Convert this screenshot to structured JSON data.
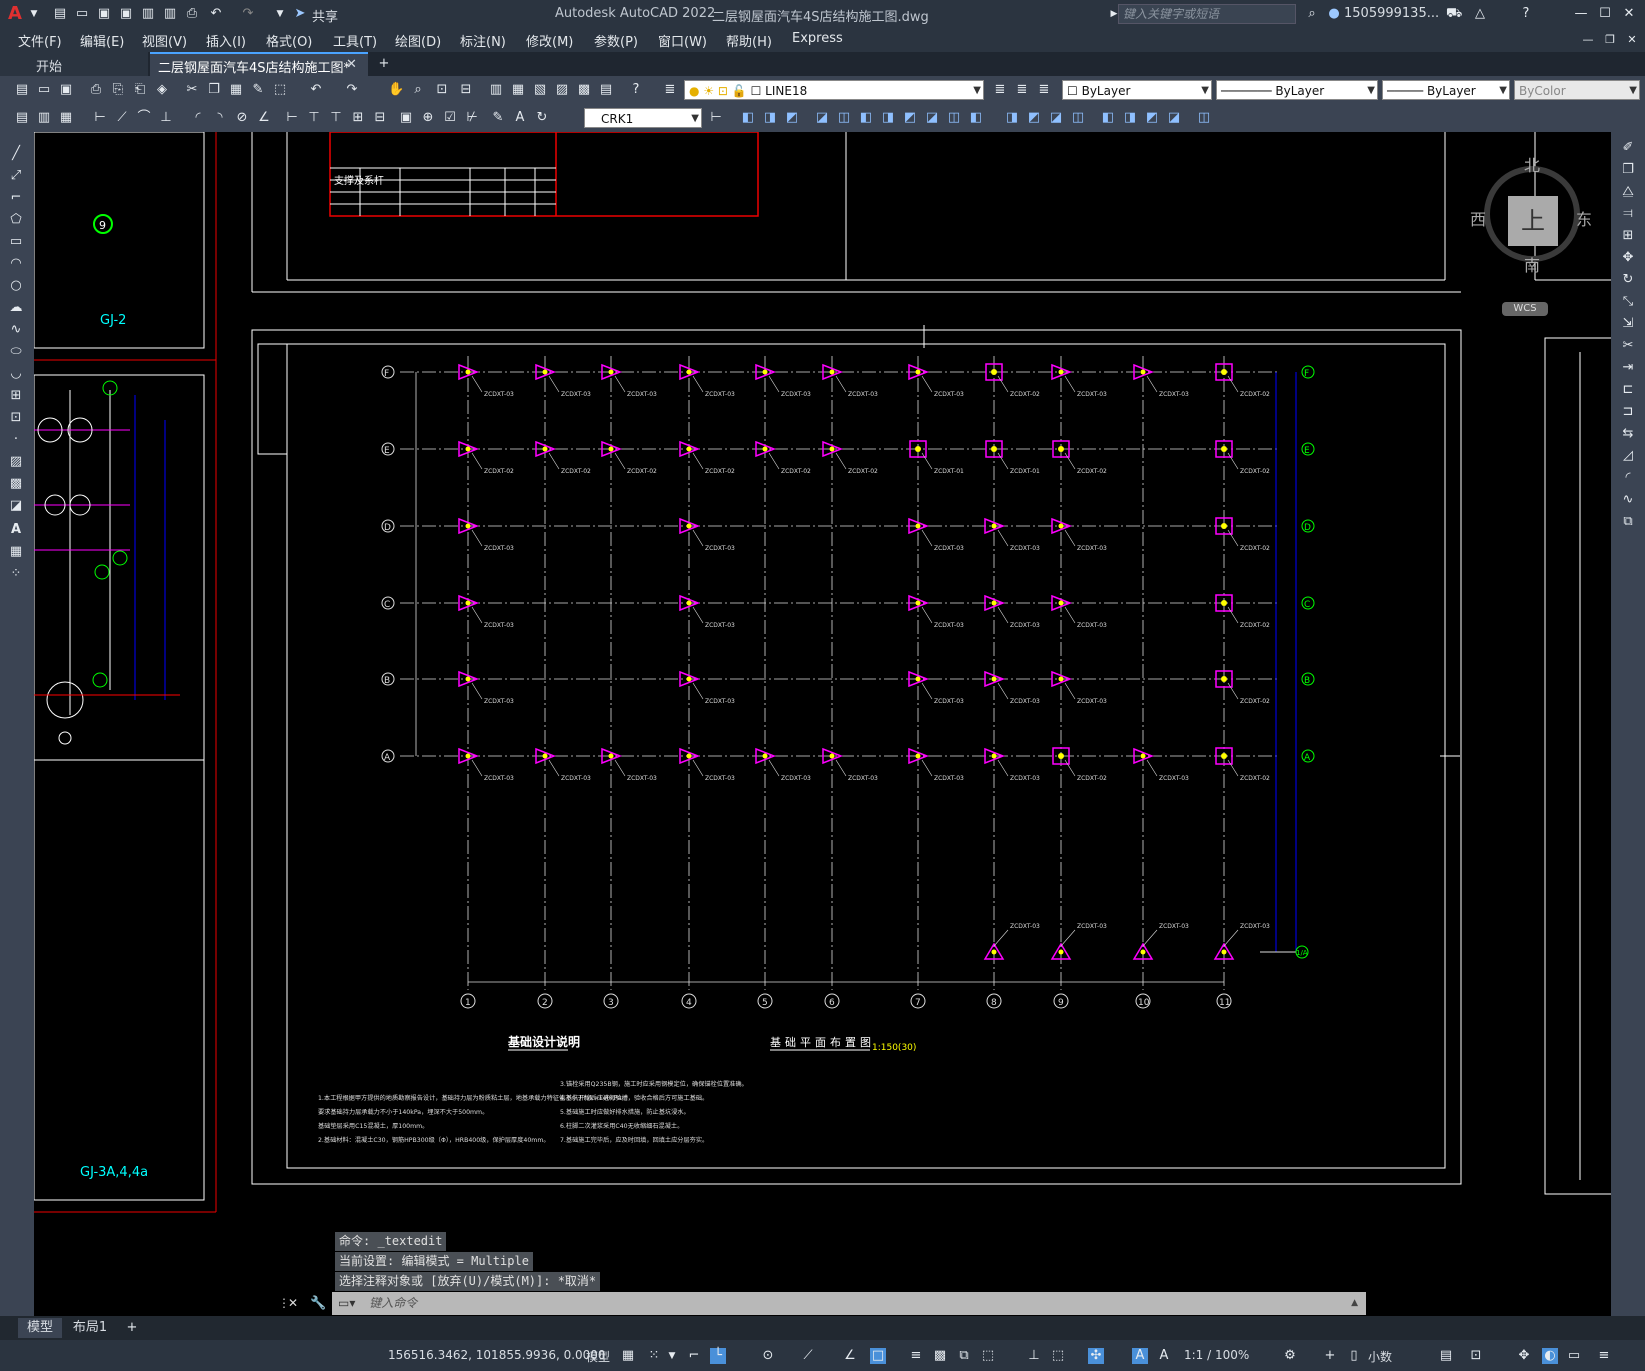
{
  "titlebar": {
    "app_title": "Autodesk AutoCAD 2022",
    "file_title": "二层钢屋面汽车4S店结构施工图.dwg",
    "share_label": "共享",
    "search_placeholder": "键入关键字或短语",
    "user": "1505999135...",
    "logo": "A"
  },
  "menu": [
    "文件(F)",
    "编辑(E)",
    "视图(V)",
    "插入(I)",
    "格式(O)",
    "工具(T)",
    "绘图(D)",
    "标注(N)",
    "修改(M)",
    "参数(P)",
    "窗口(W)",
    "帮助(H)",
    "Express"
  ],
  "tabs": {
    "start": "开始",
    "active": "二层钢屋面汽车4S店结构施工图*"
  },
  "toolbar": {
    "layer": "LINE18",
    "color": "ByLayer",
    "linetype": "ByLayer",
    "lineweight": "ByLayer",
    "plotstyle": "ByColor",
    "dimstyle": "CRK1"
  },
  "viewcube": {
    "north": "北",
    "south": "南",
    "east": "东",
    "west": "西",
    "top": "上",
    "wcs": "WCS"
  },
  "drawing": {
    "left_labels": [
      "GJ-2",
      "GJ-3A,4,4a"
    ],
    "row_axes": [
      "F",
      "E",
      "D",
      "C",
      "B",
      "A"
    ],
    "col_axes": [
      "1",
      "2",
      "3",
      "4",
      "5",
      "6",
      "7",
      "8",
      "9",
      "10",
      "11"
    ],
    "bottom_axis": "1/A",
    "foundation_title": "基础设计说明",
    "plan_title": "基础平面布置图",
    "plan_scale": "1:150(30)",
    "table_header": "支撑及系杆",
    "notes_left": [
      "1.本工程根据甲方提供的地质勘察报告设计，基础持力层为粉质粘土层，地基承载力特征值不小于fak=140kPa。",
      "要求基础持力层承载力不小于140kPa，埋深不大于500mm。",
      "基础垫层采用C15混凝土，厚100mm。",
      "2.基础材料：混凝土C30，钢筋HPB300级（Φ），HRB400级，保护层厚度40mm。"
    ],
    "notes_right": [
      "3.锚栓采用Q235B钢，施工时应采用钢模定位，确保锚栓位置准确。",
      "4.基坑开挖后应进行验槽，验收合格后方可施工基础。",
      "5.基础施工时应做好排水措施，防止基坑浸水。",
      "6.柱脚二次灌浆采用C40无收缩细石混凝土。",
      "7.基础施工完毕后，应及时回填，回填土应分层夯实。"
    ],
    "tag_label": "ZCDXT-03",
    "tag_label_b": "ZCDXT-02",
    "tag_label_c": "ZCDXT-01"
  },
  "command": {
    "history": [
      "命令: _textedit",
      "当前设置: 编辑模式 = Multiple",
      "选择注释对象或 [放弃(U)/模式(M)]: *取消*"
    ],
    "placeholder": "键入命令"
  },
  "layouts": {
    "model": "模型",
    "layout1": "布局1"
  },
  "status": {
    "coords": "156516.3462, 101855.9936, 0.0000",
    "space": "模型",
    "scale": "1:1 / 100%",
    "units": "小数"
  }
}
